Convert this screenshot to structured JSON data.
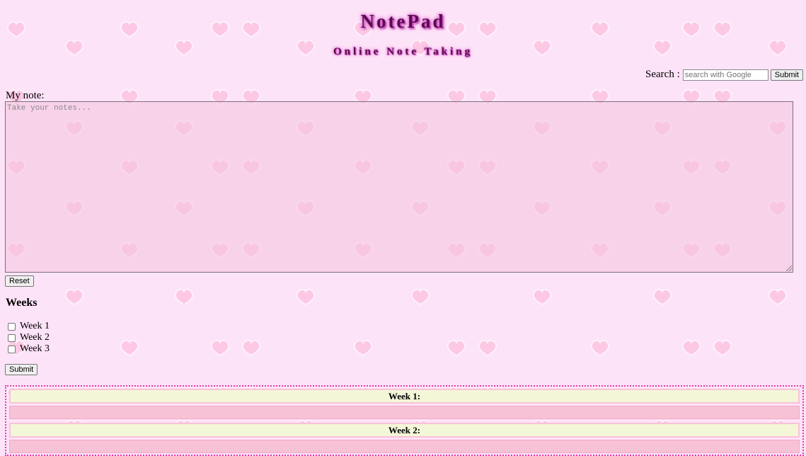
{
  "header": {
    "title": "NotePad",
    "subtitle": "Online Note Taking"
  },
  "search": {
    "label": "Search :",
    "placeholder": "search with Google",
    "submit_label": "Submit"
  },
  "note": {
    "label": "My note:",
    "placeholder": "Take your notes...",
    "reset_label": "Reset"
  },
  "weeks": {
    "heading": "Weeks",
    "options": [
      "Week 1",
      "Week 2",
      "Week 3"
    ],
    "submit_label": "Submit"
  },
  "board": {
    "sections": [
      "Week 1:",
      "Week 2:"
    ]
  },
  "colors": {
    "background": "#fde3f8",
    "heart": "#fcc8e4",
    "title_glow": "#d94bc8",
    "board_border": "#e83aa6",
    "week_header_bg": "#f4f6d8",
    "week_body_bg": "#f7c2d6"
  }
}
